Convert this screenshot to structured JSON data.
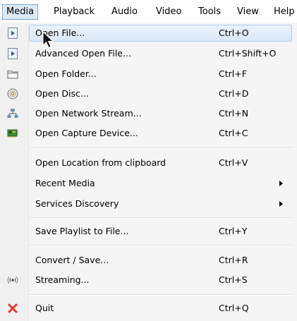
{
  "menubar": {
    "items": [
      {
        "label": "Media",
        "active": true
      },
      {
        "label": "Playback"
      },
      {
        "label": "Audio"
      },
      {
        "label": "Video"
      },
      {
        "label": "Tools"
      },
      {
        "label": "View"
      },
      {
        "label": "Help"
      }
    ]
  },
  "media_menu": {
    "highlight_color": "#dbe8f7",
    "items": [
      {
        "label": "Open File...",
        "shortcut": "Ctrl+O",
        "icon": "play-file-icon"
      },
      {
        "label": "Advanced Open File...",
        "shortcut": "Ctrl+Shift+O",
        "icon": "play-file-icon"
      },
      {
        "label": "Open Folder...",
        "shortcut": "Ctrl+F",
        "icon": "folder-icon"
      },
      {
        "label": "Open Disc...",
        "shortcut": "Ctrl+D",
        "icon": "disc-icon"
      },
      {
        "label": "Open Network Stream...",
        "shortcut": "Ctrl+N",
        "icon": "network-icon"
      },
      {
        "label": "Open Capture Device...",
        "shortcut": "Ctrl+C",
        "icon": "capture-card-icon"
      },
      {
        "label": "Open Location from clipboard",
        "shortcut": "Ctrl+V"
      },
      {
        "label": "Recent Media",
        "submenu": true
      },
      {
        "label": "Services Discovery",
        "submenu": true
      },
      {
        "label": "Save Playlist to File...",
        "shortcut": "Ctrl+Y"
      },
      {
        "label": "Convert / Save...",
        "shortcut": "Ctrl+R"
      },
      {
        "label": "Streaming...",
        "shortcut": "Ctrl+S",
        "icon": "streaming-icon"
      },
      {
        "label": "Quit",
        "shortcut": "Ctrl+Q",
        "icon": "quit-x-icon",
        "icon_color": "#e03a2f"
      }
    ]
  }
}
